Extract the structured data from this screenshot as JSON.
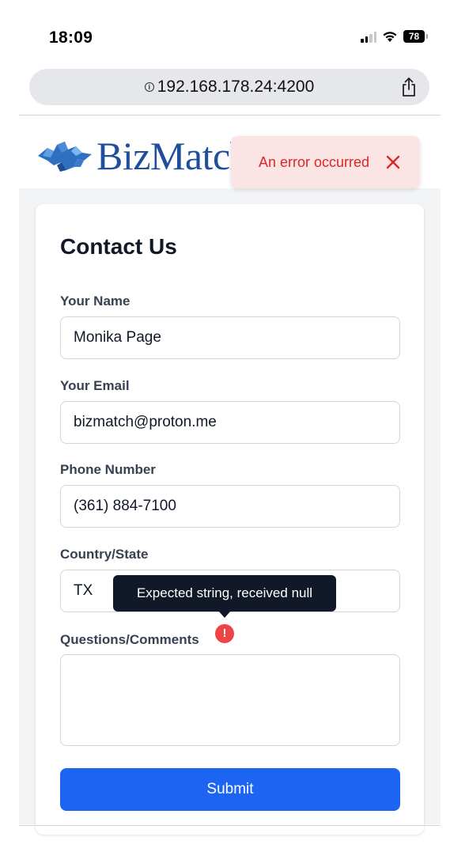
{
  "status_bar": {
    "time": "18:09",
    "battery": "78",
    "icons": [
      "signal-icon",
      "wifi-icon",
      "battery-icon"
    ]
  },
  "browser": {
    "url": "192.168.178.24:4200",
    "icons": [
      "info-icon",
      "share-icon"
    ]
  },
  "header": {
    "logo_text": "BizMatch",
    "logo_icon": "puzzle-icon"
  },
  "toast": {
    "message": "An error occurred",
    "close_icon": "close-icon",
    "color": "#dc2626"
  },
  "form": {
    "title": "Contact Us",
    "fields": {
      "name": {
        "label": "Your Name",
        "value": "Monika Page"
      },
      "email": {
        "label": "Your Email",
        "value": "bizmatch@proton.me"
      },
      "phone": {
        "label": "Phone Number",
        "value": "(361) 884-7100"
      },
      "state": {
        "label": "Country/State",
        "value": "TX"
      },
      "comments": {
        "label": "Questions/Comments",
        "value": ""
      }
    },
    "error_icon_text": "!",
    "tooltip": "Expected string, received null",
    "submit_label": "Submit",
    "accent_color": "#1d64f2",
    "error_color": "#ef4444"
  }
}
